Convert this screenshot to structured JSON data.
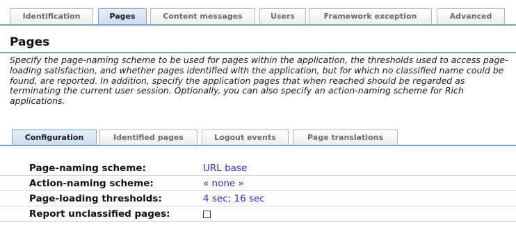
{
  "main_tabs": [
    {
      "label": "Identification"
    },
    {
      "label": "Pages",
      "active": true
    },
    {
      "label": "Content messages"
    },
    {
      "label": "Users"
    },
    {
      "label": "Framework exception"
    },
    {
      "label": "Advanced"
    }
  ],
  "page": {
    "title": "Pages",
    "description": "Specify the page-naming scheme to be used for pages within the application, the thresholds used to access page-loading satisfaction, and whether pages identified with the application, but for which no classified name could be found, are reported. In addition, specify the application pages that when reached should be regarded as terminating the current user session. Optionally, you can also specify an action-naming scheme for Rich applications."
  },
  "sub_tabs": [
    {
      "label": "Configuration",
      "active": true
    },
    {
      "label": "Identified pages"
    },
    {
      "label": "Logout events"
    },
    {
      "label": "Page translations"
    }
  ],
  "settings": {
    "page_naming": {
      "label": "Page-naming scheme:",
      "value": "URL base"
    },
    "action_naming": {
      "label": "Action-naming scheme:",
      "value": "« none »"
    },
    "thresholds": {
      "label": "Page-loading thresholds:",
      "value": "4 sec; 16 sec"
    },
    "report_unclassified": {
      "label": "Report unclassified pages:",
      "checked": false
    }
  },
  "colors": {
    "accent": "#7fa4cc",
    "link": "#2a2adb"
  }
}
